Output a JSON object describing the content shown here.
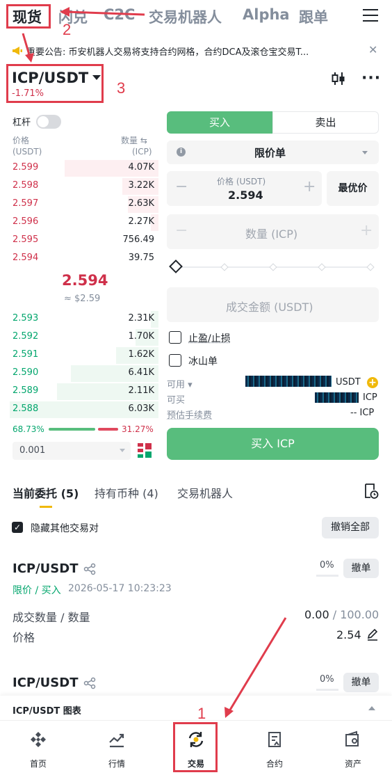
{
  "top_nav": {
    "items": [
      "现货",
      "闪兑",
      "C2C",
      "交易机器人",
      "Alpha",
      "跟单"
    ],
    "active": "现货"
  },
  "notice": {
    "text": "重要公告: 币安机器人交易将支持合约网格，合约DCA及滚仓宝交易T..."
  },
  "pair": {
    "symbol": "ICP/USDT",
    "change": "-1.71%"
  },
  "orderbook": {
    "leverage_label": "杠杆",
    "price_header": "价格",
    "price_unit": "(USDT)",
    "qty_header": "数量 ⇆",
    "qty_unit": "(ICP)",
    "asks": [
      {
        "price": "2.599",
        "qty": "4.07K",
        "depth": 0.62
      },
      {
        "price": "2.598",
        "qty": "3.22K",
        "depth": 0.24
      },
      {
        "price": "2.597",
        "qty": "2.63K",
        "depth": 0.2
      },
      {
        "price": "2.596",
        "qty": "2.27K",
        "depth": 0.05
      },
      {
        "price": "2.595",
        "qty": "756.49",
        "depth": 0.0
      },
      {
        "price": "2.594",
        "qty": "39.75",
        "depth": 0.0
      }
    ],
    "mid_price": "2.594",
    "mid_fiat": "≈ $2.59",
    "bids": [
      {
        "price": "2.593",
        "qty": "2.31K",
        "depth": 0.05
      },
      {
        "price": "2.592",
        "qty": "1.70K",
        "depth": 0.15
      },
      {
        "price": "2.591",
        "qty": "1.62K",
        "depth": 0.28
      },
      {
        "price": "2.590",
        "qty": "6.41K",
        "depth": 0.58
      },
      {
        "price": "2.589",
        "qty": "2.11K",
        "depth": 0.67
      },
      {
        "price": "2.588",
        "qty": "6.03K",
        "depth": 0.98
      }
    ],
    "buy_ratio": "68.73%",
    "sell_ratio": "31.27%",
    "buy_ratio_value": 0.6873,
    "precision": "0.001"
  },
  "trade_form": {
    "buy_tab": "买入",
    "sell_tab": "卖出",
    "order_type": "限价单",
    "price_label": "价格 (USDT)",
    "price_value": "2.594",
    "best_price": "最优价",
    "qty_placeholder": "数量 (ICP)",
    "amount_placeholder": "成交金额 (USDT)",
    "tp_sl": "止盈/止损",
    "iceberg": "冰山单",
    "available_label": "可用",
    "available_unit": "USDT",
    "buyable_label": "可买",
    "buyable_unit": "ICP",
    "fee_label": "预估手续费",
    "fee_value": "-- ICP",
    "submit": "买入 ICP"
  },
  "orders_section": {
    "tabs": [
      "当前委托 (5)",
      "持有币种 (4)",
      "交易机器人"
    ],
    "hide_other_pairs": "隐藏其他交易对",
    "cancel_all": "撤销全部",
    "orders": [
      {
        "pair": "ICP/USDT",
        "type": "限价 / 买入",
        "time": "2026-05-17 10:23:23",
        "fill_pct": "0%",
        "cancel": "撤单",
        "filled_label": "成交数量 / 数量",
        "filled": "0.00",
        "total": "/ 100.00",
        "price_label": "价格",
        "price": "2.54"
      },
      {
        "pair": "ICP/USDT",
        "fill_pct": "0%",
        "cancel": "撤单"
      }
    ]
  },
  "chart_bar": {
    "label": "ICP/USDT 图表"
  },
  "bottom_nav": [
    {
      "label": "首页",
      "icon": "home-icon"
    },
    {
      "label": "行情",
      "icon": "markets-icon"
    },
    {
      "label": "交易",
      "icon": "trade-icon"
    },
    {
      "label": "合约",
      "icon": "futures-icon"
    },
    {
      "label": "资产",
      "icon": "wallet-icon"
    }
  ],
  "annotations": {
    "labels": [
      "1",
      "2",
      "3"
    ],
    "color": "#e03c4c"
  },
  "colors": {
    "buy_green": "#58bd7d",
    "ask_red": "#cf304a",
    "bid_green": "#03a66d",
    "accent_yellow": "#f0b90b"
  }
}
